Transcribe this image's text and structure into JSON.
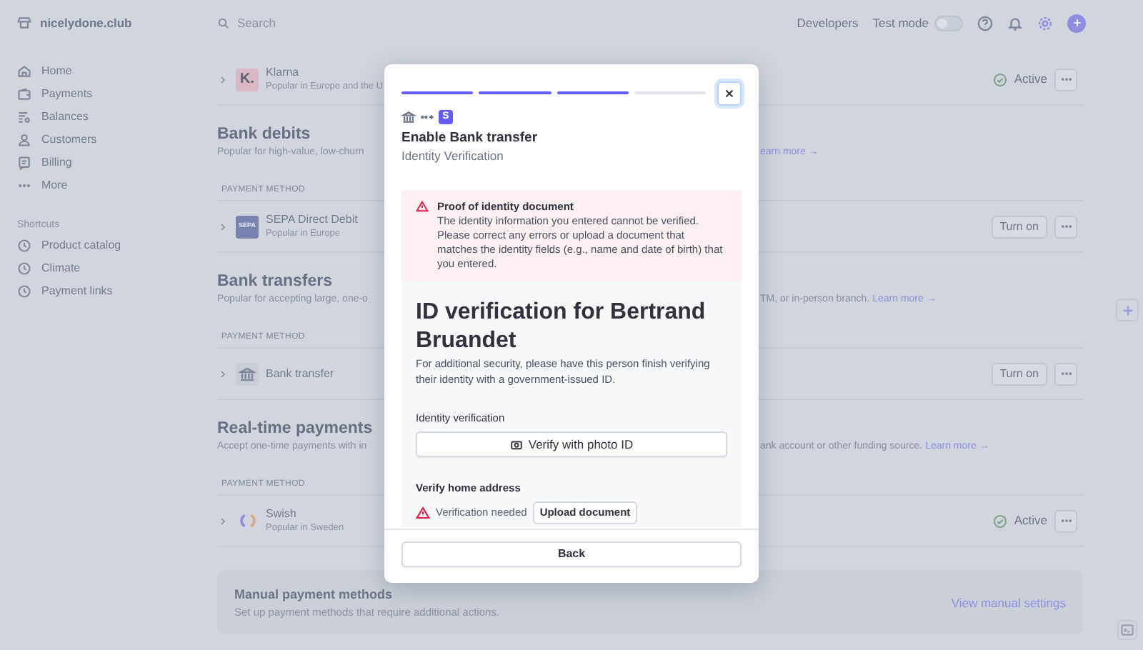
{
  "topbar": {
    "account": "nicelydone.club",
    "search": {
      "placeholder": "Search"
    },
    "link": "Developers",
    "test_mode": {
      "label": "Test mode",
      "on": false
    }
  },
  "sidebar": {
    "items": [
      {
        "label": "Home"
      },
      {
        "label": "Payments"
      },
      {
        "label": "Balances"
      },
      {
        "label": "Customers"
      },
      {
        "label": "Billing"
      },
      {
        "label": "More"
      }
    ],
    "shortcuts": {
      "heading": "Shortcuts",
      "items": [
        {
          "label": "Product catalog"
        },
        {
          "label": "Climate"
        },
        {
          "label": "Payment links"
        }
      ]
    }
  },
  "sections": [
    {
      "rows": [
        {
          "logo": {
            "kind": "letter",
            "text": "K."
          },
          "name": "Klarna",
          "subtitle": "Popular in Europe and the U",
          "status": {
            "kind": "active",
            "label": "Active"
          }
        }
      ]
    },
    {
      "title": "Bank debits",
      "description": "Popular for high-value, low-churn",
      "link": "earn more →",
      "column": "PAYMENT METHOD",
      "rows": [
        {
          "logo": {
            "kind": "letter",
            "text": "SEPA"
          },
          "name": "SEPA Direct Debit",
          "subtitle": "Popular in Europe",
          "status": {
            "kind": "button",
            "label": "Turn on"
          }
        }
      ]
    },
    {
      "title": "Bank transfers",
      "description": "Popular for accepting large, one-o",
      "description_after": "TM, or in-person branch.",
      "link": "Learn more →",
      "column": "PAYMENT METHOD",
      "rows": [
        {
          "logo": {
            "kind": "bank"
          },
          "name": "Bank transfer",
          "status": {
            "kind": "button",
            "label": "Turn on"
          }
        }
      ]
    },
    {
      "title": "Real-time payments",
      "description": "Accept one-time payments with in",
      "description_after": "ank account or other funding source.",
      "link": "Learn more →",
      "column": "PAYMENT METHOD",
      "rows": [
        {
          "logo": {
            "kind": "swirl"
          },
          "name": "Swish",
          "subtitle": "Popular in Sweden",
          "status": {
            "kind": "active",
            "label": "Active"
          }
        }
      ]
    }
  ],
  "manual": {
    "title": "Manual payment methods",
    "text": "Set up payment methods that require additional actions.",
    "link": "View manual settings"
  },
  "modal": {
    "progress": [
      {
        "done": true
      },
      {
        "done": true
      },
      {
        "done": true
      },
      {
        "done": false
      }
    ],
    "brand_mark": "S",
    "title": "Enable Bank transfer",
    "subtitle": "Identity Verification",
    "alert": {
      "title": "Proof of identity document",
      "message": "The identity information you entered cannot be verified. Please correct any errors or upload a document that matches the identity fields (e.g., name and date of birth) that you entered."
    },
    "heading": "ID verification for Bertrand Bruandet",
    "text": "For additional security, please have this person finish verifying their identity with a government-issued ID.",
    "identity_label": "Identity verification",
    "verify_button": "Verify with photo ID",
    "address_label": "Verify home address",
    "address_status": "Verification needed",
    "upload_button": "Upload document",
    "back_button": "Back"
  }
}
